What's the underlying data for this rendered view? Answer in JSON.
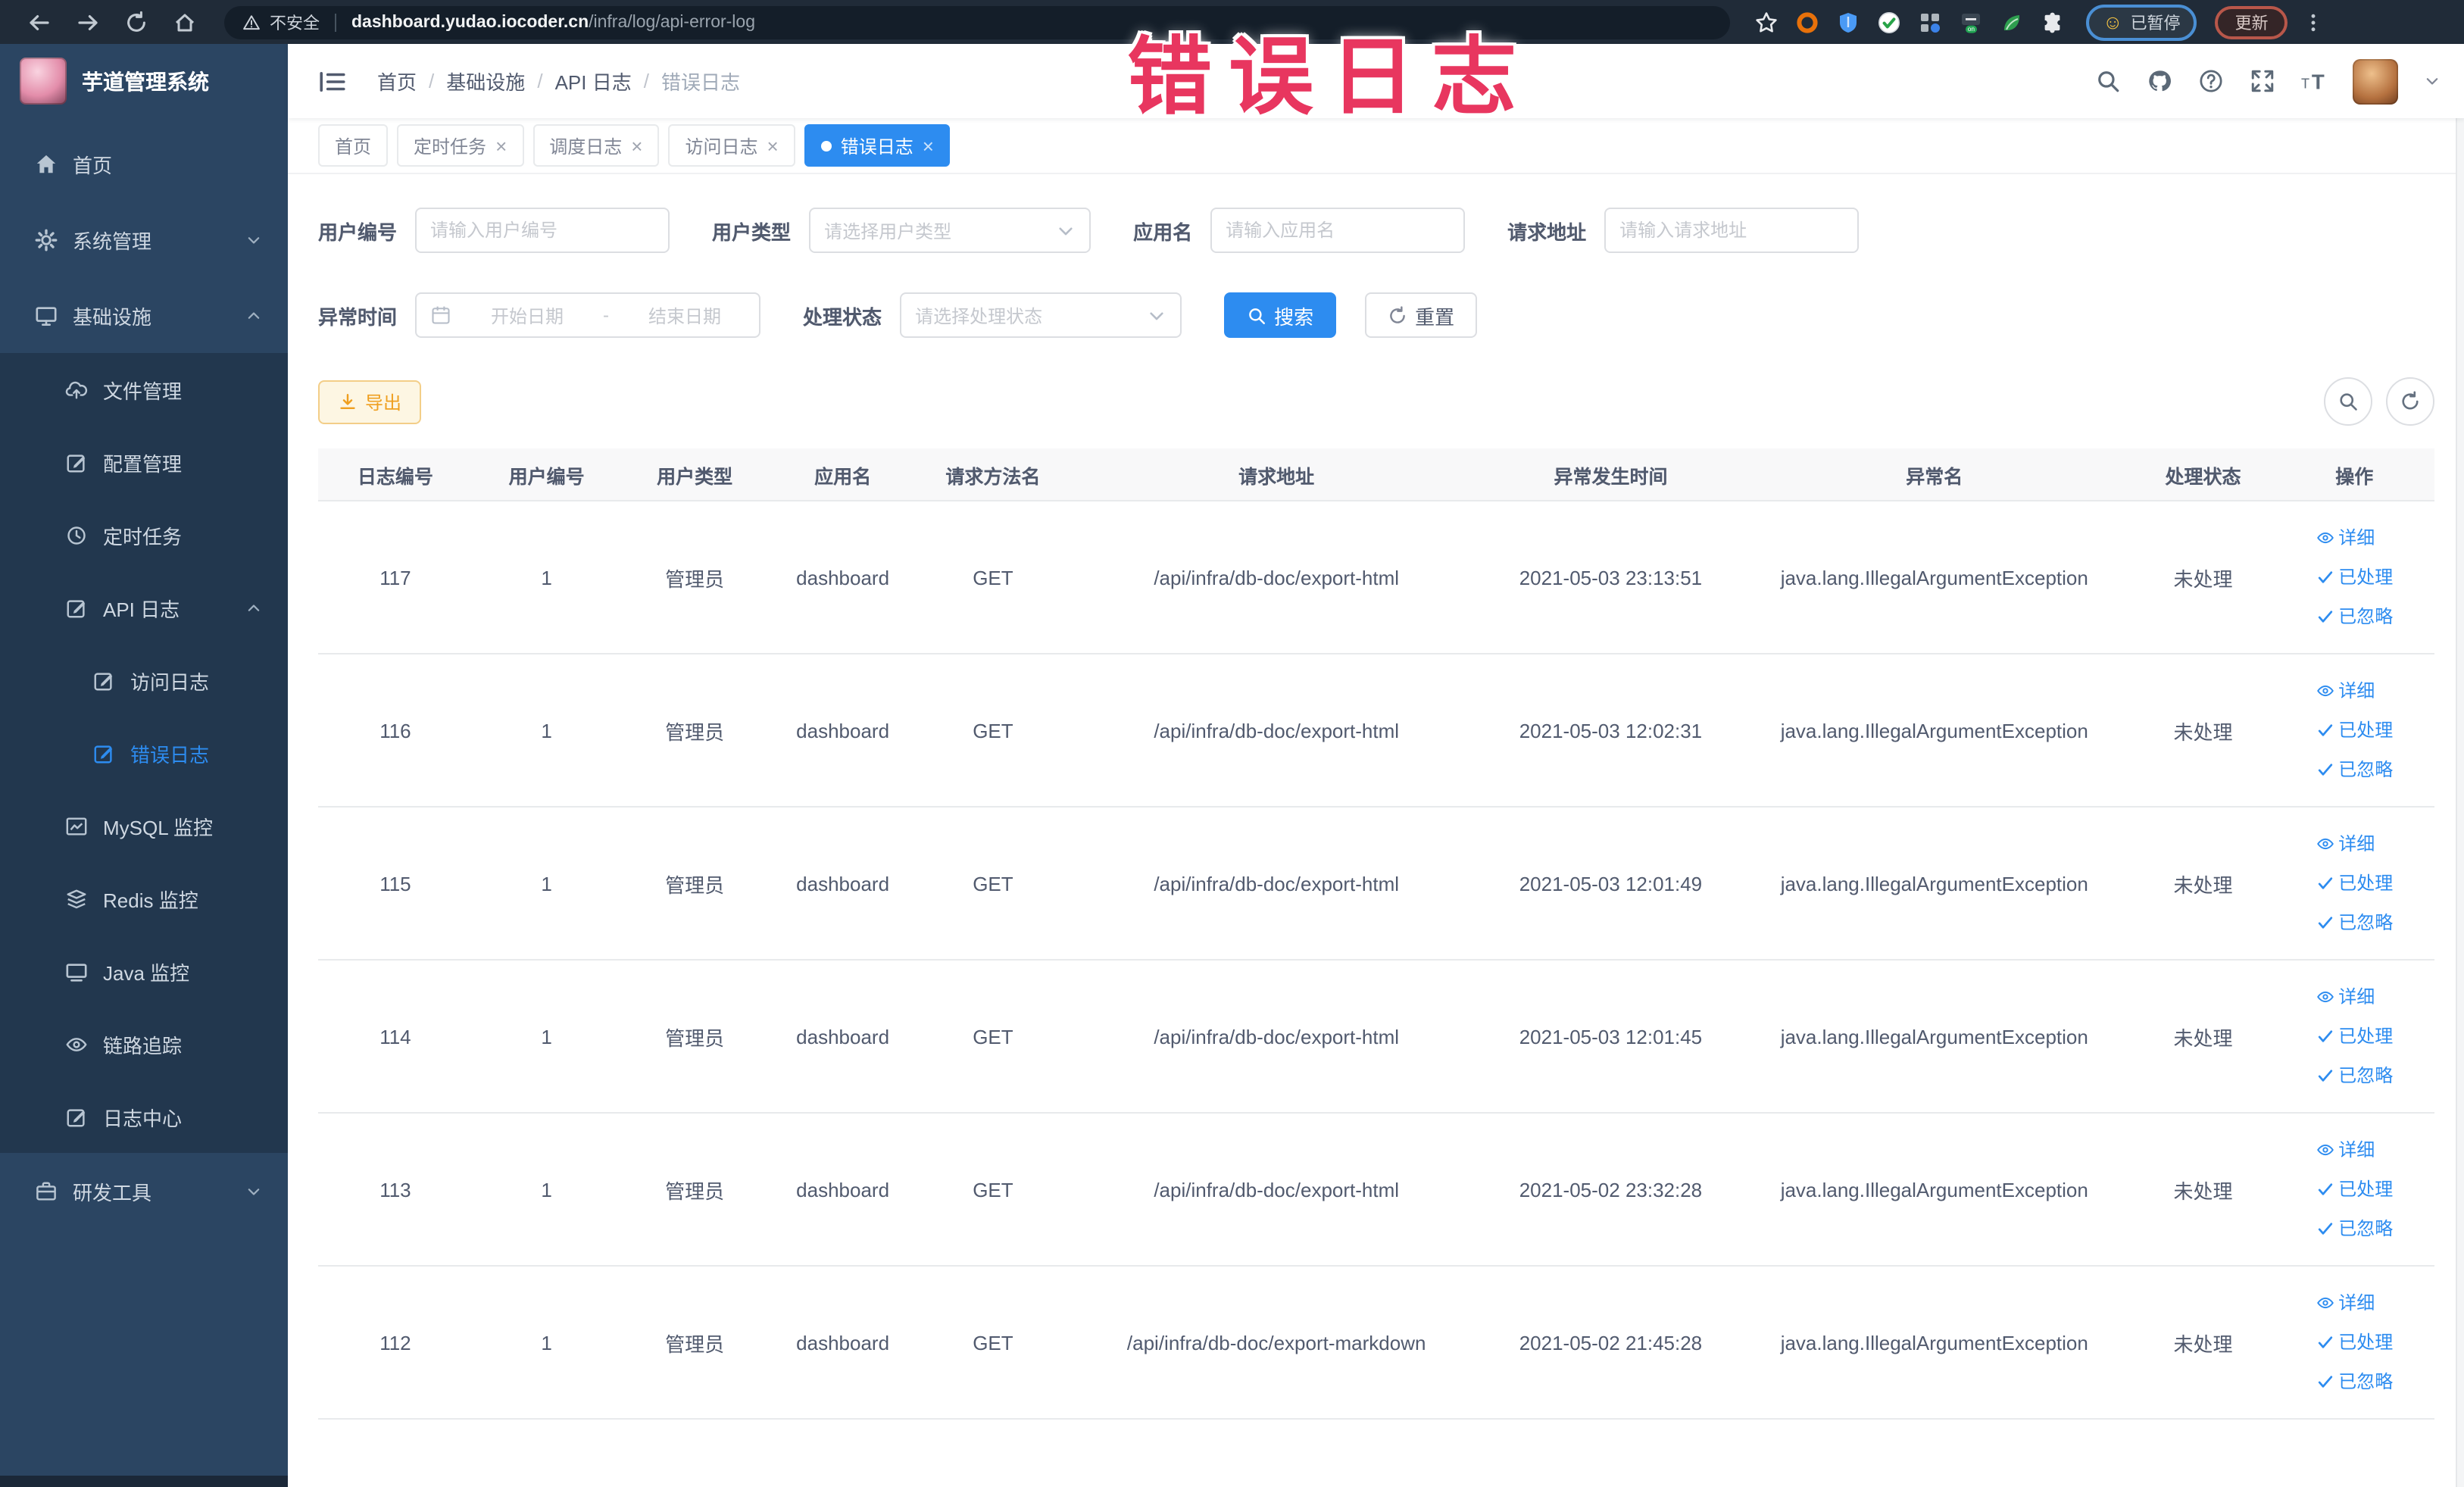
{
  "browser": {
    "security_label": "不安全",
    "url_domain": "dashboard.yudao.iocoder.cn",
    "url_path": "/infra/log/api-error-log",
    "paused_label": "已暂停",
    "update_label": "更新",
    "nav_icons": [
      "back-icon",
      "forward-icon",
      "reload-icon",
      "browser-home-icon"
    ],
    "extension_icons": [
      "bookmark-star-icon",
      "orange-ring-extension-icon",
      "blue-shield-extension-icon",
      "green-check-extension-icon",
      "grid-extension-icon",
      "switch-on-extension-icon",
      "leaf-extension-icon",
      "puzzle-extensions-icon"
    ]
  },
  "overlay": {
    "title": "错误日志"
  },
  "sidebar": {
    "logo_title": "芋道管理系统",
    "items": [
      {
        "label": "首页",
        "icon": "home-icon",
        "level": 1
      },
      {
        "label": "系统管理",
        "icon": "gear-icon",
        "level": 1,
        "chevron": "down"
      },
      {
        "label": "基础设施",
        "icon": "monitor-icon",
        "level": 1,
        "chevron": "up"
      },
      {
        "label": "文件管理",
        "icon": "cloud-upload-icon",
        "level": 2,
        "submenu": true
      },
      {
        "label": "配置管理",
        "icon": "edit-square-icon",
        "level": 2,
        "submenu": true
      },
      {
        "label": "定时任务",
        "icon": "clock-icon",
        "level": 2,
        "submenu": true
      },
      {
        "label": "API 日志",
        "icon": "log-edit-icon",
        "level": 2,
        "submenu": true,
        "chevron": "up"
      },
      {
        "label": "访问日志",
        "icon": "log-edit-icon",
        "level": 3,
        "submenu": true
      },
      {
        "label": "错误日志",
        "icon": "log-edit-icon",
        "level": 3,
        "submenu": true,
        "active": true
      },
      {
        "label": "MySQL 监控",
        "icon": "chart-frame-icon",
        "level": 2,
        "submenu": true
      },
      {
        "label": "Redis 监控",
        "icon": "layers-icon",
        "level": 2,
        "submenu": true
      },
      {
        "label": "Java 监控",
        "icon": "display-icon",
        "level": 2,
        "submenu": true
      },
      {
        "label": "链路追踪",
        "icon": "eye-icon",
        "level": 2,
        "submenu": true
      },
      {
        "label": "日志中心",
        "icon": "log-edit-icon",
        "level": 2,
        "submenu": true
      },
      {
        "label": "研发工具",
        "icon": "briefcase-icon",
        "level": 1,
        "chevron": "down"
      }
    ]
  },
  "header": {
    "breadcrumb": [
      "首页",
      "基础设施",
      "API 日志",
      "错误日志"
    ],
    "icons": [
      "search-icon",
      "github-icon",
      "help-icon",
      "fullscreen-icon",
      "text-size-icon"
    ]
  },
  "tabs": [
    {
      "label": "首页",
      "closable": false,
      "active": false
    },
    {
      "label": "定时任务",
      "closable": true,
      "active": false
    },
    {
      "label": "调度日志",
      "closable": true,
      "active": false
    },
    {
      "label": "访问日志",
      "closable": true,
      "active": false
    },
    {
      "label": "错误日志",
      "closable": true,
      "active": true
    }
  ],
  "filters": {
    "user_id": {
      "label": "用户编号",
      "placeholder": "请输入用户编号"
    },
    "user_type": {
      "label": "用户类型",
      "placeholder": "请选择用户类型"
    },
    "app_name": {
      "label": "应用名",
      "placeholder": "请输入应用名"
    },
    "request_url": {
      "label": "请求地址",
      "placeholder": "请输入请求地址"
    },
    "exception_time": {
      "label": "异常时间",
      "start_placeholder": "开始日期",
      "separator": "-",
      "end_placeholder": "结束日期"
    },
    "process_status": {
      "label": "处理状态",
      "placeholder": "请选择处理状态"
    },
    "search_label": "搜索",
    "reset_label": "重置"
  },
  "toolbar": {
    "export_label": "导出"
  },
  "table": {
    "columns": [
      {
        "key": "id",
        "label": "日志编号",
        "width": "7.3%"
      },
      {
        "key": "user_id",
        "label": "用户编号",
        "width": "7.0%"
      },
      {
        "key": "user_type",
        "label": "用户类型",
        "width": "7.0%"
      },
      {
        "key": "app_name",
        "label": "应用名",
        "width": "7.0%"
      },
      {
        "key": "method",
        "label": "请求方法名",
        "width": "7.2%"
      },
      {
        "key": "url",
        "label": "请求地址",
        "width": "19.6%"
      },
      {
        "key": "time",
        "label": "异常发生时间",
        "width": "12.0%"
      },
      {
        "key": "exception",
        "label": "异常名",
        "width": "18.6%"
      },
      {
        "key": "status",
        "label": "处理状态",
        "width": "6.8%"
      },
      {
        "key": "op",
        "label": "操作",
        "width": "7.5%"
      }
    ],
    "rows": [
      {
        "id": "117",
        "user_id": "1",
        "user_type": "管理员",
        "app_name": "dashboard",
        "method": "GET",
        "url": "/api/infra/db-doc/export-html",
        "time": "2021-05-03 23:13:51",
        "exception": "java.lang.IllegalArgumentException",
        "status": "未处理"
      },
      {
        "id": "116",
        "user_id": "1",
        "user_type": "管理员",
        "app_name": "dashboard",
        "method": "GET",
        "url": "/api/infra/db-doc/export-html",
        "time": "2021-05-03 12:02:31",
        "exception": "java.lang.IllegalArgumentException",
        "status": "未处理"
      },
      {
        "id": "115",
        "user_id": "1",
        "user_type": "管理员",
        "app_name": "dashboard",
        "method": "GET",
        "url": "/api/infra/db-doc/export-html",
        "time": "2021-05-03 12:01:49",
        "exception": "java.lang.IllegalArgumentException",
        "status": "未处理"
      },
      {
        "id": "114",
        "user_id": "1",
        "user_type": "管理员",
        "app_name": "dashboard",
        "method": "GET",
        "url": "/api/infra/db-doc/export-html",
        "time": "2021-05-03 12:01:45",
        "exception": "java.lang.IllegalArgumentException",
        "status": "未处理"
      },
      {
        "id": "113",
        "user_id": "1",
        "user_type": "管理员",
        "app_name": "dashboard",
        "method": "GET",
        "url": "/api/infra/db-doc/export-html",
        "time": "2021-05-02 23:32:28",
        "exception": "java.lang.IllegalArgumentException",
        "status": "未处理"
      },
      {
        "id": "112",
        "user_id": "1",
        "user_type": "管理员",
        "app_name": "dashboard",
        "method": "GET",
        "url": "/api/infra/db-doc/export-markdown",
        "time": "2021-05-02 21:45:28",
        "exception": "java.lang.IllegalArgumentException",
        "status": "未处理"
      }
    ],
    "actions": [
      {
        "label": "详细",
        "icon": "eye-icon"
      },
      {
        "label": "已处理",
        "icon": "check-icon"
      },
      {
        "label": "已忽略",
        "icon": "check-icon"
      }
    ]
  }
}
